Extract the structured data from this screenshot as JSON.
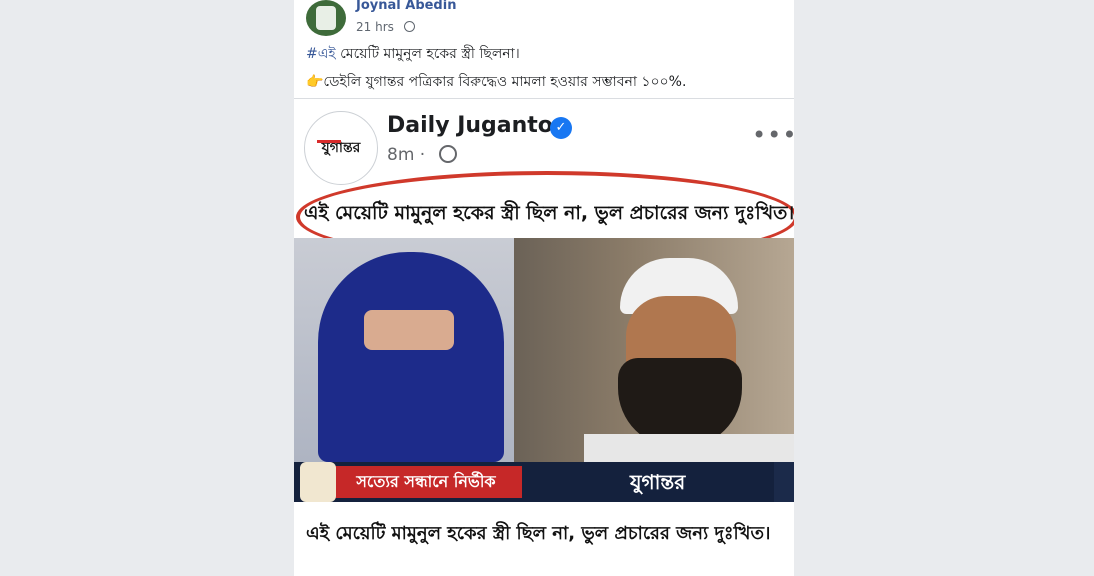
{
  "outer_post": {
    "author": "Joynal Abedin",
    "time": "21 hrs",
    "hashtag": "#এই",
    "line1_rest": " মেয়েটি মামুনুল হকের স্ত্রী ছিলনা।",
    "line2": "👉ডেইলি যুগান্তর পত্রিকার বিরুদ্ধেও মামলা হওয়ার সম্ভাবনা ১০০%."
  },
  "inner_post": {
    "page_name": "Daily Jugantor",
    "logo_text": "যুগান্তর",
    "time": "8m",
    "more": "•••",
    "headline": "এই মেয়েটি মামুনুল হকের স্ত্রী ছিল না, ভুল প্রচারের জন্য দুঃখিত।",
    "banner_slogan": "সত্যের সন্ধানে নির্ভীক",
    "banner_brand": "যুগান্তর"
  },
  "link_preview": {
    "caption": "এই মেয়েটি মামুনুল হকের স্ত্রী ছিল না, ভুল প্রচারের জন্য দুঃখিত।"
  },
  "colors": {
    "accent": "#385898",
    "verified": "#1877f2",
    "highlight_circle": "#d0392b",
    "banner_red": "#c62828",
    "banner_navy": "#14213d"
  }
}
